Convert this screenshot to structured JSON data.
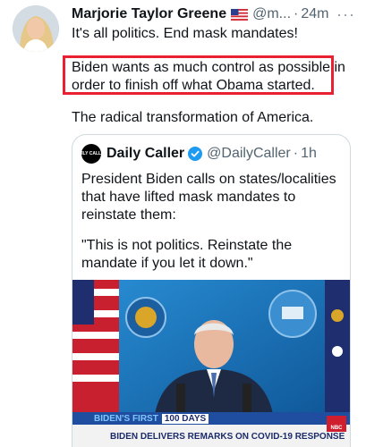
{
  "tweet": {
    "author_name": "Marjorie Taylor Greene",
    "handle": "@m...",
    "separator": "·",
    "time": "24m",
    "more_label": "···",
    "line1": "It's all politics.  End mask mandates!",
    "highlighted_line1": "Biden wants as much control as possible in",
    "highlighted_line2": "order to finish off what Obama started.",
    "line3": "The radical transformation of America."
  },
  "quote": {
    "avatar_text": "DAILY CALLER",
    "author_name": "Daily Caller",
    "handle": "@DailyCaller",
    "separator": "·",
    "time": "1h",
    "lines": [
      "President Biden calls on states/localities",
      "that have lifted mask mandates to",
      "reinstate them:",
      "\"This is not politics. Reinstate the",
      "mandate if you let it down.\""
    ]
  },
  "media": {
    "banner_top_part1": "BIDEN'S FIRST",
    "banner_top_part2": "100 DAYS",
    "banner_bottom": "BIDEN DELIVERS REMARKS ON COVID-19 RESPONSE",
    "network_logo": "NBC"
  },
  "colors": {
    "highlight_border": "#e8202f",
    "verified": "#1d9bf0",
    "muted_text": "#536471"
  }
}
